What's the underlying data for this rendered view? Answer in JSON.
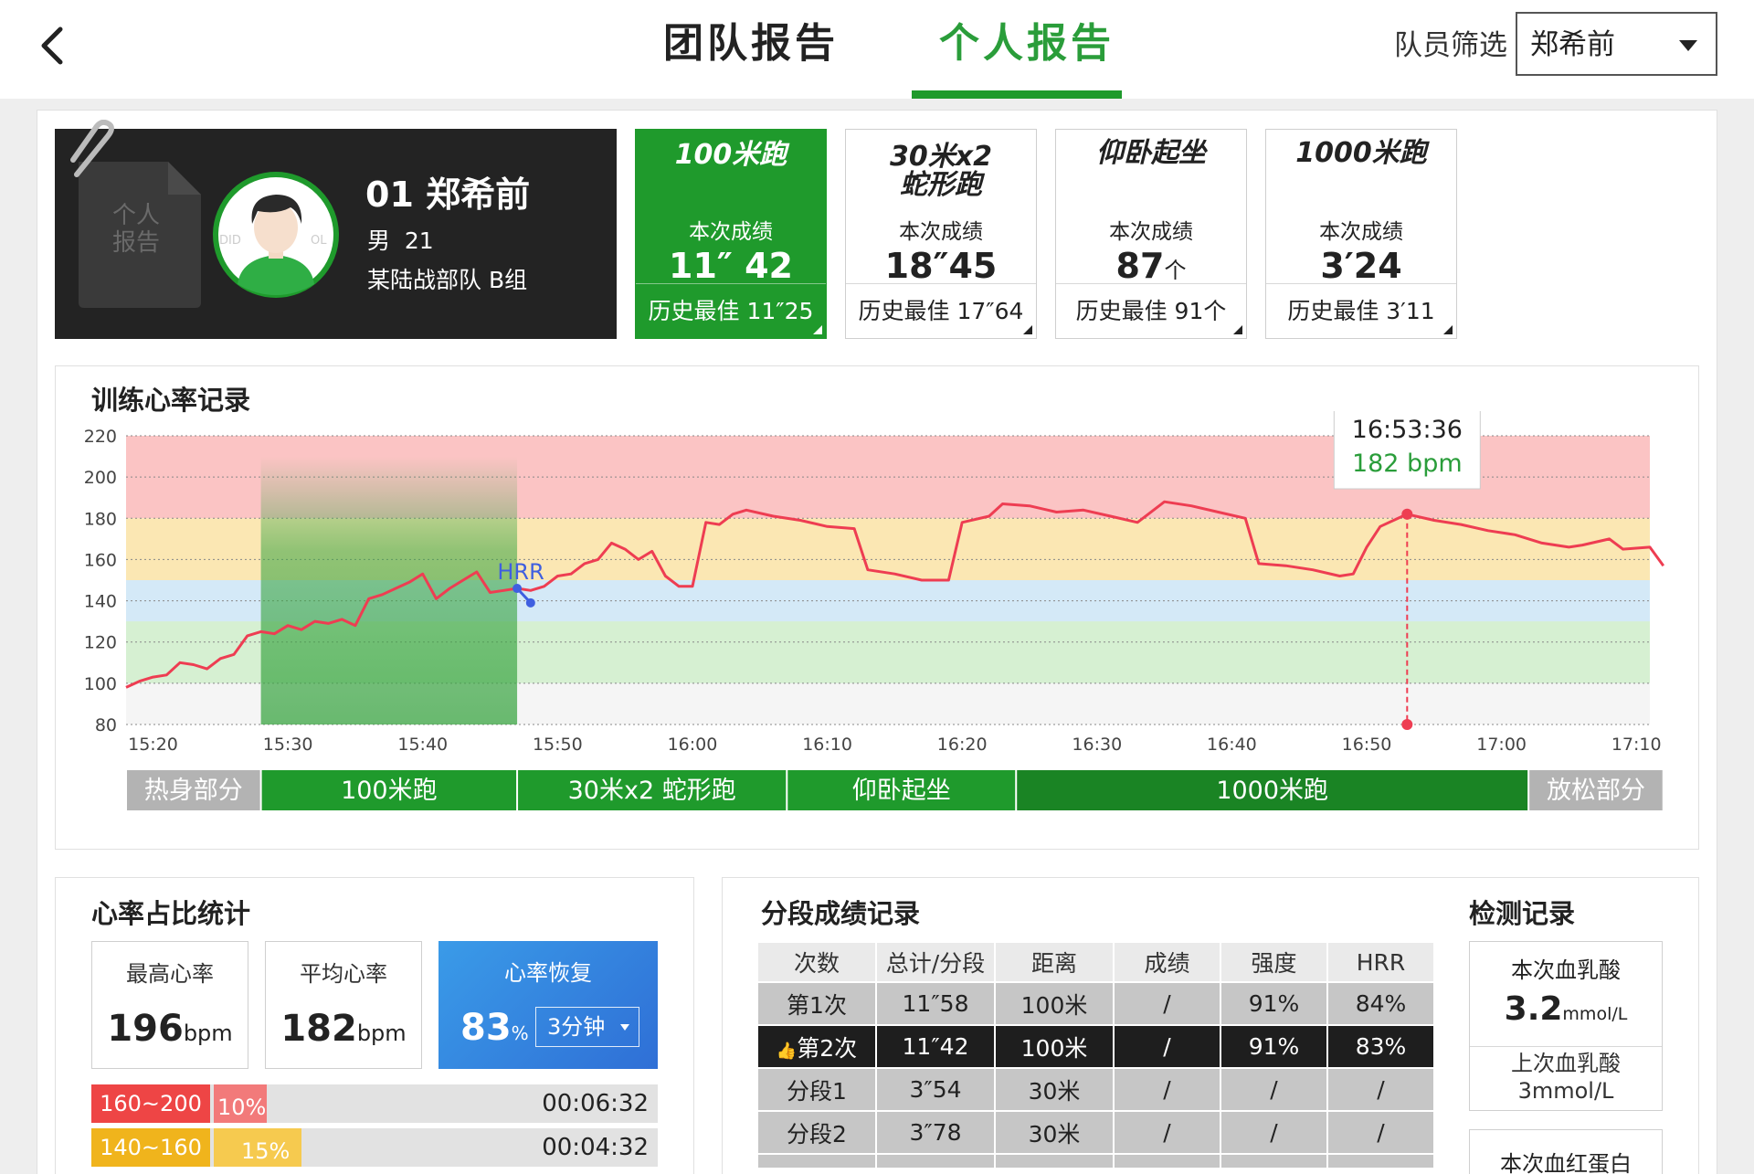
{
  "header": {
    "tabs": [
      {
        "label": "团队报告",
        "active": false
      },
      {
        "label": "个人报告",
        "active": true
      }
    ],
    "filter_label": "队员筛选",
    "filter_value": "郑希前"
  },
  "profile": {
    "badge": "个人\n报告",
    "number_name": "01 郑希前",
    "gender_age": "男  21",
    "unit": "某陆战部队 B组"
  },
  "events": [
    {
      "name": "100米跑",
      "score_label": "本次成绩",
      "score": "11″ 42",
      "best": "历史最佳 11″25",
      "active": true
    },
    {
      "name": "30米x2\n蛇形跑",
      "score_label": "本次成绩",
      "score": "18″45",
      "best": "历史最佳 17″64",
      "active": false
    },
    {
      "name": "仰卧起坐",
      "score_label": "本次成绩",
      "score": "87",
      "score_unit": "个",
      "best": "历史最佳 91个",
      "active": false
    },
    {
      "name": "1000米跑",
      "score_label": "本次成绩",
      "score": "3′24",
      "best": "历史最佳 3′11",
      "active": false
    }
  ],
  "hr_card": {
    "title": "训练心率记录"
  },
  "chart_data": {
    "type": "line",
    "title": "训练心率记录",
    "ylim": [
      80,
      220
    ],
    "yticks": [
      220,
      200,
      180,
      160,
      140,
      120,
      100,
      80
    ],
    "xlim": [
      "15:18",
      "17:11"
    ],
    "xticks": [
      "15:20",
      "15:30",
      "15:40",
      "15:50",
      "16:00",
      "16:10",
      "16:20",
      "16:30",
      "16:40",
      "16:50",
      "17:00",
      "17:10"
    ],
    "zones": [
      {
        "from": 180,
        "to": 220,
        "color": "#fbc4c4"
      },
      {
        "from": 150,
        "to": 180,
        "color": "#fbe7b3"
      },
      {
        "from": 100,
        "to": 150,
        "color": "#d4e9f7"
      },
      {
        "from": 100,
        "to": 130,
        "color": "#d6f0d2"
      },
      {
        "from": 80,
        "to": 100,
        "color": "#f5f5f5"
      }
    ],
    "highlight": {
      "from": "15:28",
      "to": "15:47"
    },
    "series": [
      {
        "color": "#ee3d52",
        "points": [
          [
            "15:18",
            98
          ],
          [
            "15:19",
            101
          ],
          [
            "15:20",
            103
          ],
          [
            "15:21",
            104
          ],
          [
            "15:22",
            110
          ],
          [
            "15:23",
            109
          ],
          [
            "15:24",
            107
          ],
          [
            "15:25",
            112
          ],
          [
            "15:26",
            114
          ],
          [
            "15:27",
            123
          ],
          [
            "15:28",
            125
          ],
          [
            "15:29",
            124
          ],
          [
            "15:30",
            128
          ],
          [
            "15:31",
            126
          ],
          [
            "15:32",
            130
          ],
          [
            "15:33",
            129
          ],
          [
            "15:34",
            131
          ],
          [
            "15:35",
            128
          ],
          [
            "15:36",
            141
          ],
          [
            "15:37",
            143
          ],
          [
            "15:38",
            146
          ],
          [
            "15:39",
            149
          ],
          [
            "15:40",
            153
          ],
          [
            "15:41",
            141
          ],
          [
            "15:42",
            146
          ],
          [
            "15:43",
            150
          ],
          [
            "15:44",
            154
          ],
          [
            "15:45",
            144
          ],
          [
            "15:46",
            145
          ],
          [
            "15:47",
            146
          ],
          [
            "15:48",
            145
          ],
          [
            "15:49",
            147
          ],
          [
            "15:50",
            152
          ],
          [
            "15:51",
            153
          ],
          [
            "15:52",
            158
          ],
          [
            "15:53",
            160
          ],
          [
            "15:54",
            168
          ],
          [
            "15:55",
            165
          ],
          [
            "15:56",
            160
          ],
          [
            "15:57",
            164
          ],
          [
            "15:58",
            152
          ],
          [
            "15:59",
            147
          ],
          [
            "16:00",
            147
          ],
          [
            "16:01",
            178
          ],
          [
            "16:02",
            177
          ],
          [
            "16:03",
            182
          ],
          [
            "16:04",
            184
          ],
          [
            "16:06",
            181
          ],
          [
            "16:08",
            179
          ],
          [
            "16:10",
            176
          ],
          [
            "16:12",
            175
          ],
          [
            "16:13",
            155
          ],
          [
            "16:15",
            153
          ],
          [
            "16:17",
            150
          ],
          [
            "16:19",
            150
          ],
          [
            "16:20",
            178
          ],
          [
            "16:22",
            181
          ],
          [
            "16:23",
            187
          ],
          [
            "16:25",
            186
          ],
          [
            "16:27",
            183
          ],
          [
            "16:29",
            184
          ],
          [
            "16:31",
            181
          ],
          [
            "16:33",
            178
          ],
          [
            "16:35",
            188
          ],
          [
            "16:37",
            186
          ],
          [
            "16:39",
            183
          ],
          [
            "16:41",
            180
          ],
          [
            "16:42",
            158
          ],
          [
            "16:44",
            157
          ],
          [
            "16:46",
            155
          ],
          [
            "16:48",
            152
          ],
          [
            "16:49",
            153
          ],
          [
            "16:50",
            166
          ],
          [
            "16:51",
            176
          ],
          [
            "16:52",
            179
          ],
          [
            "16:53",
            182
          ],
          [
            "16:55",
            179
          ],
          [
            "16:57",
            177
          ],
          [
            "16:59",
            174
          ],
          [
            "17:01",
            172
          ],
          [
            "17:03",
            168
          ],
          [
            "17:05",
            166
          ],
          [
            "17:06",
            167
          ],
          [
            "17:08",
            170
          ],
          [
            "17:09",
            165
          ],
          [
            "17:11",
            166
          ],
          [
            "17:12",
            157
          ]
        ]
      }
    ],
    "hrr_marker": {
      "label": "HRR",
      "points": [
        [
          "15:47",
          146
        ],
        [
          "15:48",
          139
        ]
      ],
      "color": "#3f5fe0"
    },
    "tooltip": {
      "time": "16:53:36",
      "value": "182 bpm",
      "x": "16:53",
      "y": 182
    },
    "phases": [
      {
        "name": "热身部分",
        "from": "15:18",
        "to": "15:28",
        "color": "#b3b3b3"
      },
      {
        "name": "100米跑",
        "from": "15:28",
        "to": "15:47",
        "color": "#1f9a2c"
      },
      {
        "name": "30米x2 蛇形跑",
        "from": "15:47",
        "to": "16:07",
        "color": "#1f9a2c"
      },
      {
        "name": "仰卧起坐",
        "from": "16:07",
        "to": "16:24",
        "color": "#1f9a2c"
      },
      {
        "name": "1000米跑",
        "from": "16:24",
        "to": "17:02",
        "color": "#1a8424"
      },
      {
        "name": "放松部分",
        "from": "17:02",
        "to": "17:12",
        "color": "#b3b3b3"
      }
    ]
  },
  "hr_stats": {
    "title": "心率占比统计",
    "max_label": "最高心率",
    "max_value": "196",
    "max_unit": "bpm",
    "avg_label": "平均心率",
    "avg_value": "182",
    "avg_unit": "bpm",
    "recovery_label": "心率恢复",
    "recovery_value": "83",
    "recovery_unit": "%",
    "recovery_select": "3分钟",
    "zones": [
      {
        "range": "160~200",
        "pct": "10%",
        "pct_value": 10,
        "time": "00:06:32",
        "color": "#ee4545",
        "pct_color": "#f27a7a"
      },
      {
        "range": "140~160",
        "pct": "15%",
        "pct_value": 15,
        "time": "00:04:32",
        "color": "#f0b41c",
        "pct_color": "#f6ca4f"
      }
    ]
  },
  "segments": {
    "title": "分段成绩记录",
    "headers": [
      "次数",
      "总计/分段",
      "距离",
      "成绩",
      "强度",
      "HRR"
    ],
    "rows": [
      {
        "cells": [
          "第1次",
          "11″58",
          "100米",
          "/",
          "91%",
          "84%"
        ],
        "selected": false
      },
      {
        "cells": [
          "第2次",
          "11″42",
          "100米",
          "/",
          "91%",
          "83%"
        ],
        "selected": true
      },
      {
        "cells": [
          "分段1",
          "3″54",
          "30米",
          "/",
          "/",
          "/"
        ],
        "selected": false
      },
      {
        "cells": [
          "分段2",
          "3″78",
          "30米",
          "/",
          "/",
          "/"
        ],
        "selected": false
      }
    ]
  },
  "detection": {
    "title": "检测记录",
    "current_label": "本次血乳酸",
    "current_value": "3.2",
    "current_unit": "mmol/L",
    "last_label": "上次血乳酸",
    "last_value": "3mmol/L",
    "next_label": "本次血红蛋白"
  }
}
